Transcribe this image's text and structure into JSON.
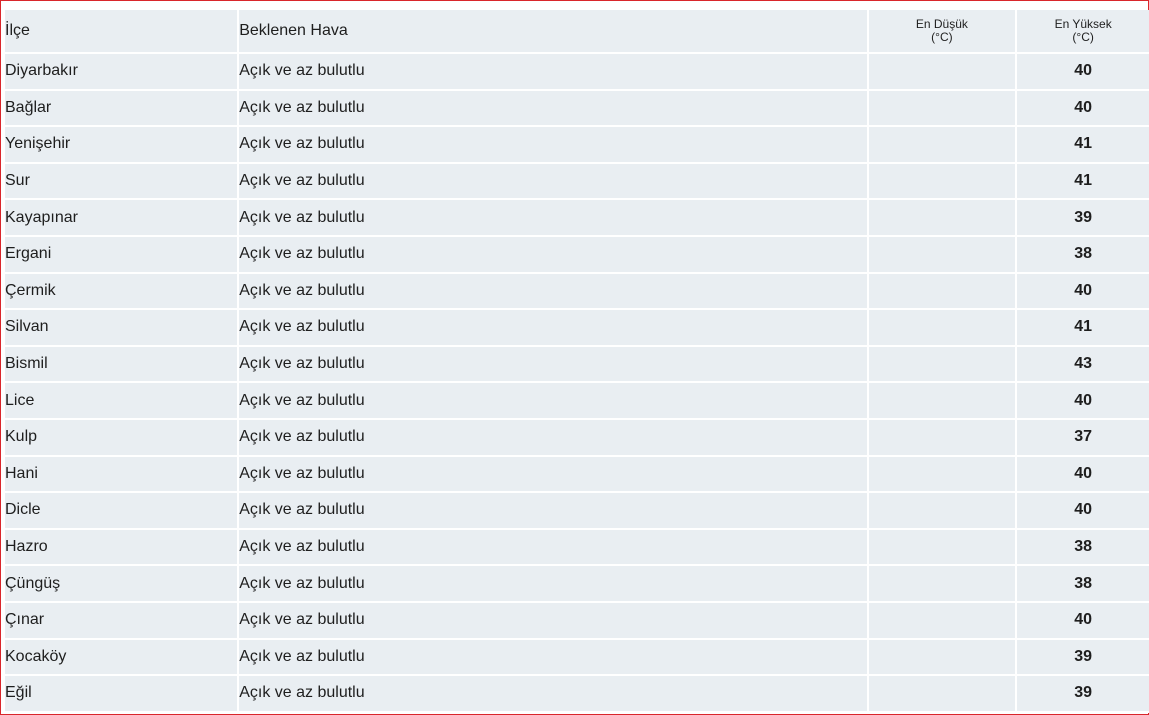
{
  "headers": {
    "district": "İlçe",
    "forecast": "Beklenen Hava",
    "min_line1": "En Düşük",
    "min_line2": "(°C)",
    "max_line1": "En Yüksek",
    "max_line2": "(°C)"
  },
  "colors": {
    "frame_border": "#d9262b",
    "row_background": "#e9eef2",
    "max_temp_text": "#d8413c"
  },
  "rows": [
    {
      "district": "Diyarbakır",
      "forecast": "Açık ve az bulutlu",
      "min": "",
      "max": "40"
    },
    {
      "district": "Bağlar",
      "forecast": "Açık ve az bulutlu",
      "min": "",
      "max": "40"
    },
    {
      "district": "Yenişehir",
      "forecast": "Açık ve az bulutlu",
      "min": "",
      "max": "41"
    },
    {
      "district": "Sur",
      "forecast": "Açık ve az bulutlu",
      "min": "",
      "max": "41"
    },
    {
      "district": "Kayapınar",
      "forecast": "Açık ve az bulutlu",
      "min": "",
      "max": "39"
    },
    {
      "district": "Ergani",
      "forecast": "Açık ve az bulutlu",
      "min": "",
      "max": "38"
    },
    {
      "district": "Çermik",
      "forecast": "Açık ve az bulutlu",
      "min": "",
      "max": "40"
    },
    {
      "district": "Silvan",
      "forecast": "Açık ve az bulutlu",
      "min": "",
      "max": "41"
    },
    {
      "district": "Bismil",
      "forecast": "Açık ve az bulutlu",
      "min": "",
      "max": "43"
    },
    {
      "district": "Lice",
      "forecast": "Açık ve az bulutlu",
      "min": "",
      "max": "40"
    },
    {
      "district": "Kulp",
      "forecast": "Açık ve az bulutlu",
      "min": "",
      "max": "37"
    },
    {
      "district": "Hani",
      "forecast": "Açık ve az bulutlu",
      "min": "",
      "max": "40"
    },
    {
      "district": "Dicle",
      "forecast": "Açık ve az bulutlu",
      "min": "",
      "max": "40"
    },
    {
      "district": "Hazro",
      "forecast": "Açık ve az bulutlu",
      "min": "",
      "max": "38"
    },
    {
      "district": "Çüngüş",
      "forecast": "Açık ve az bulutlu",
      "min": "",
      "max": "38"
    },
    {
      "district": "Çınar",
      "forecast": "Açık ve az bulutlu",
      "min": "",
      "max": "40"
    },
    {
      "district": "Kocaköy",
      "forecast": "Açık ve az bulutlu",
      "min": "",
      "max": "39"
    },
    {
      "district": "Eğil",
      "forecast": "Açık ve az bulutlu",
      "min": "",
      "max": "39"
    }
  ]
}
